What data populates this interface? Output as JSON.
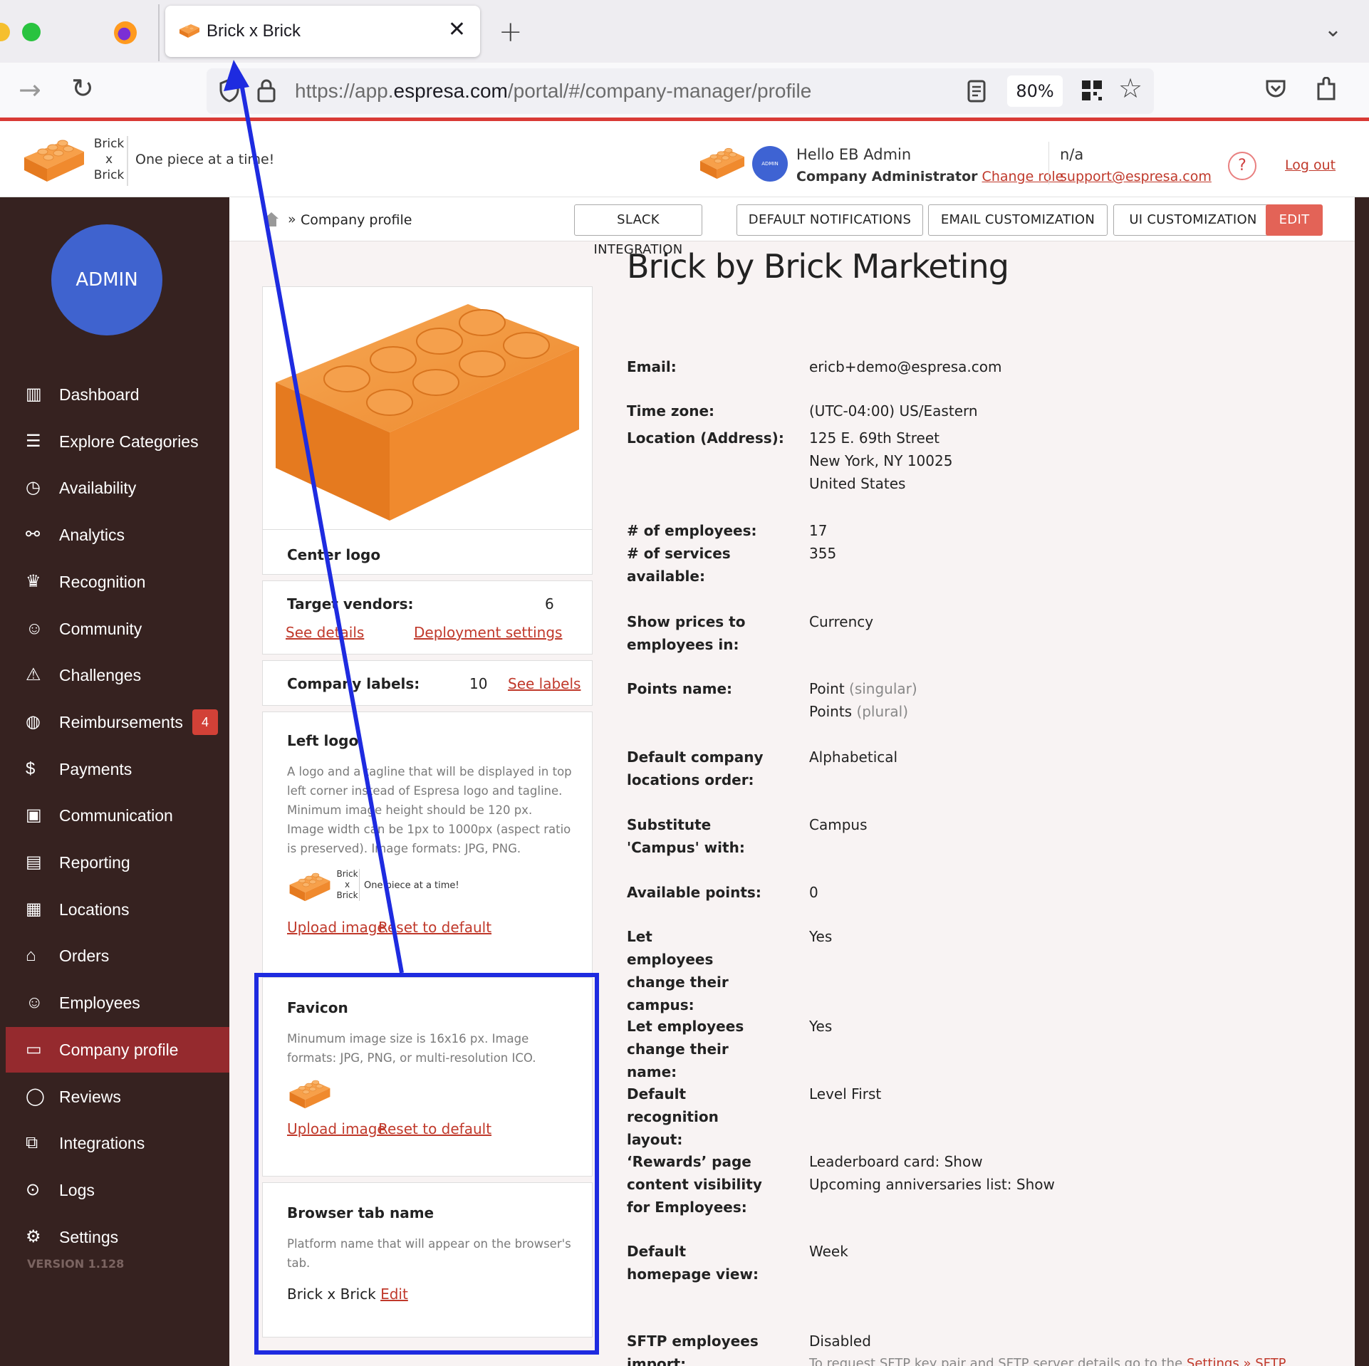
{
  "browser": {
    "tab_title": "Brick x Brick",
    "url_domain_pre": "https://app.",
    "url_domain": "espresa.com",
    "url_path": "/portal/#/company-manager/profile",
    "zoom": "80%"
  },
  "header": {
    "brand_line1": "Brick",
    "brand_line2": "x",
    "brand_line3": "Brick",
    "tagline": "One piece at a time!",
    "avatar_text": "ADMIN",
    "greeting": "Hello EB Admin",
    "role": "Company Administrator",
    "change_role": "Change role",
    "na": "n/a",
    "support_email": "support@espresa.com",
    "help": "?",
    "logout": "Log out"
  },
  "sidebar": {
    "avatar_text": "ADMIN",
    "items": [
      {
        "label": "Dashboard"
      },
      {
        "label": "Explore Categories"
      },
      {
        "label": "Availability"
      },
      {
        "label": "Analytics"
      },
      {
        "label": "Recognition"
      },
      {
        "label": "Community"
      },
      {
        "label": "Challenges"
      },
      {
        "label": "Reimbursements",
        "badge": "4"
      },
      {
        "label": "Payments"
      },
      {
        "label": "Communication"
      },
      {
        "label": "Reporting"
      },
      {
        "label": "Locations"
      },
      {
        "label": "Orders"
      },
      {
        "label": "Employees"
      },
      {
        "label": "Company profile",
        "active": true
      },
      {
        "label": "Reviews"
      },
      {
        "label": "Integrations"
      },
      {
        "label": "Logs"
      },
      {
        "label": "Settings"
      }
    ],
    "version": "VERSION 1.128"
  },
  "toolbar": {
    "crumb_sep": "»",
    "crumb": "Company profile",
    "buttons": [
      "SLACK INTEGRATION",
      "DEFAULT NOTIFICATIONS",
      "EMAIL CUSTOMIZATION",
      "UI CUSTOMIZATION",
      "EDIT"
    ]
  },
  "left_cards": {
    "center_logo": "Center logo",
    "target_vendors_label": "Target vendors:",
    "target_vendors_value": "6",
    "see_details": "See details",
    "deployment_settings": "Deployment settings",
    "company_labels_label": "Company labels:",
    "company_labels_value": "10",
    "see_labels": "See labels",
    "left_logo_title": "Left logo",
    "left_logo_desc": "A logo and a tagline that will be displayed in top left corner instead of Espresa logo and tagline. Minimum image height should be 120 px. Image width can be 1px to 1000px (aspect ratio is preserved). Image formats: JPG, PNG.",
    "preview_brand_line1": "Brick",
    "preview_brand_line2": "x",
    "preview_brand_line3": "Brick",
    "preview_tagline": "One piece at a time!",
    "upload_image": "Upload image",
    "reset_default": "Reset to default",
    "favicon_title": "Favicon",
    "favicon_desc": "Minumum image size is 16x16 px. Image formats: JPG, PNG, or multi-resolution ICO.",
    "browser_tab_title": "Browser tab name",
    "browser_tab_desc": "Platform name that will appear on the browser's tab.",
    "browser_tab_value": "Brick x Brick",
    "edit": "Edit"
  },
  "profile": {
    "company_name": "Brick by Brick Marketing",
    "fields": [
      {
        "label": "Email:",
        "value": "ericb+demo@espresa.com"
      },
      {
        "label": "Time zone:",
        "value": "(UTC-04:00) US/Eastern"
      },
      {
        "label": "Location (Address):",
        "value1": "125 E. 69th Street",
        "value2": "New York, NY 10025",
        "value3": "United States"
      },
      {
        "label": "# of employees:",
        "value": "17"
      },
      {
        "label": "# of services available:",
        "value": "355"
      },
      {
        "label": "Show prices to employees in:",
        "value": "Currency"
      },
      {
        "label": "Points name:",
        "value1": "Point",
        "value1_muted": "(singular)",
        "value2": "Points",
        "value2_muted": "(plural)"
      },
      {
        "label": "Default company locations order:",
        "value": "Alphabetical"
      },
      {
        "label": "Substitute 'Campus' with:",
        "value": "Campus"
      },
      {
        "label": "Available points:",
        "value": "0"
      },
      {
        "label": "Let employees change their campus:",
        "value": "Yes"
      },
      {
        "label": "Let employees change their name:",
        "value": "Yes"
      },
      {
        "label": "Default recognition layout:",
        "value": "Level First"
      },
      {
        "label": "‘Rewards’ page content visibility for Employees:",
        "value1": "Leaderboard card: Show",
        "value2": "Upcoming anniversaries list: Show"
      },
      {
        "label": "Default homepage view:",
        "value": "Week"
      },
      {
        "label": "SFTP employees import:",
        "value": "Disabled",
        "note": "To request SFTP key pair and SFTP server details go to the",
        "note_link": "Settings » SFTP"
      }
    ]
  },
  "colors": {
    "accent_red": "#c0392b",
    "sidebar_bg": "#362220",
    "sidebar_active": "#952a2e",
    "avatar_blue": "#3f63cf",
    "annotation_blue": "#1e2be0"
  }
}
